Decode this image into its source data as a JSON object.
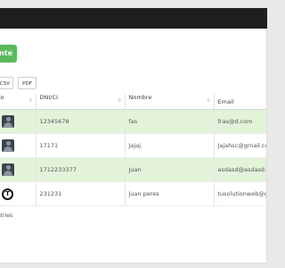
{
  "header": {
    "add_button_label": "nte"
  },
  "export": {
    "csv_label": "CSV",
    "pdf_label": "PDF"
  },
  "table": {
    "columns": [
      "oto",
      "DNI/CI",
      "Nombre",
      "Email"
    ],
    "rows": [
      {
        "photo": "avatar",
        "dni": "12345678",
        "nombre": "fas",
        "email": "fras@d.com"
      },
      {
        "photo": "avatar",
        "dni": "17171",
        "nombre": "Jajaj",
        "email": "Jajahsc@gmail.com"
      },
      {
        "photo": "avatar",
        "dni": "1712233377",
        "nombre": "Juan",
        "email": "asdasd@asdasd.co"
      },
      {
        "photo": "logo",
        "dni": "231231",
        "nombre": "juan peres",
        "email": "tusolutionweb@gm"
      }
    ]
  },
  "footer": {
    "info": "ntries"
  },
  "colors": {
    "accent": "#5cb85c",
    "row_highlight": "#e3f3da",
    "dark_bar": "#1f1f1f"
  }
}
